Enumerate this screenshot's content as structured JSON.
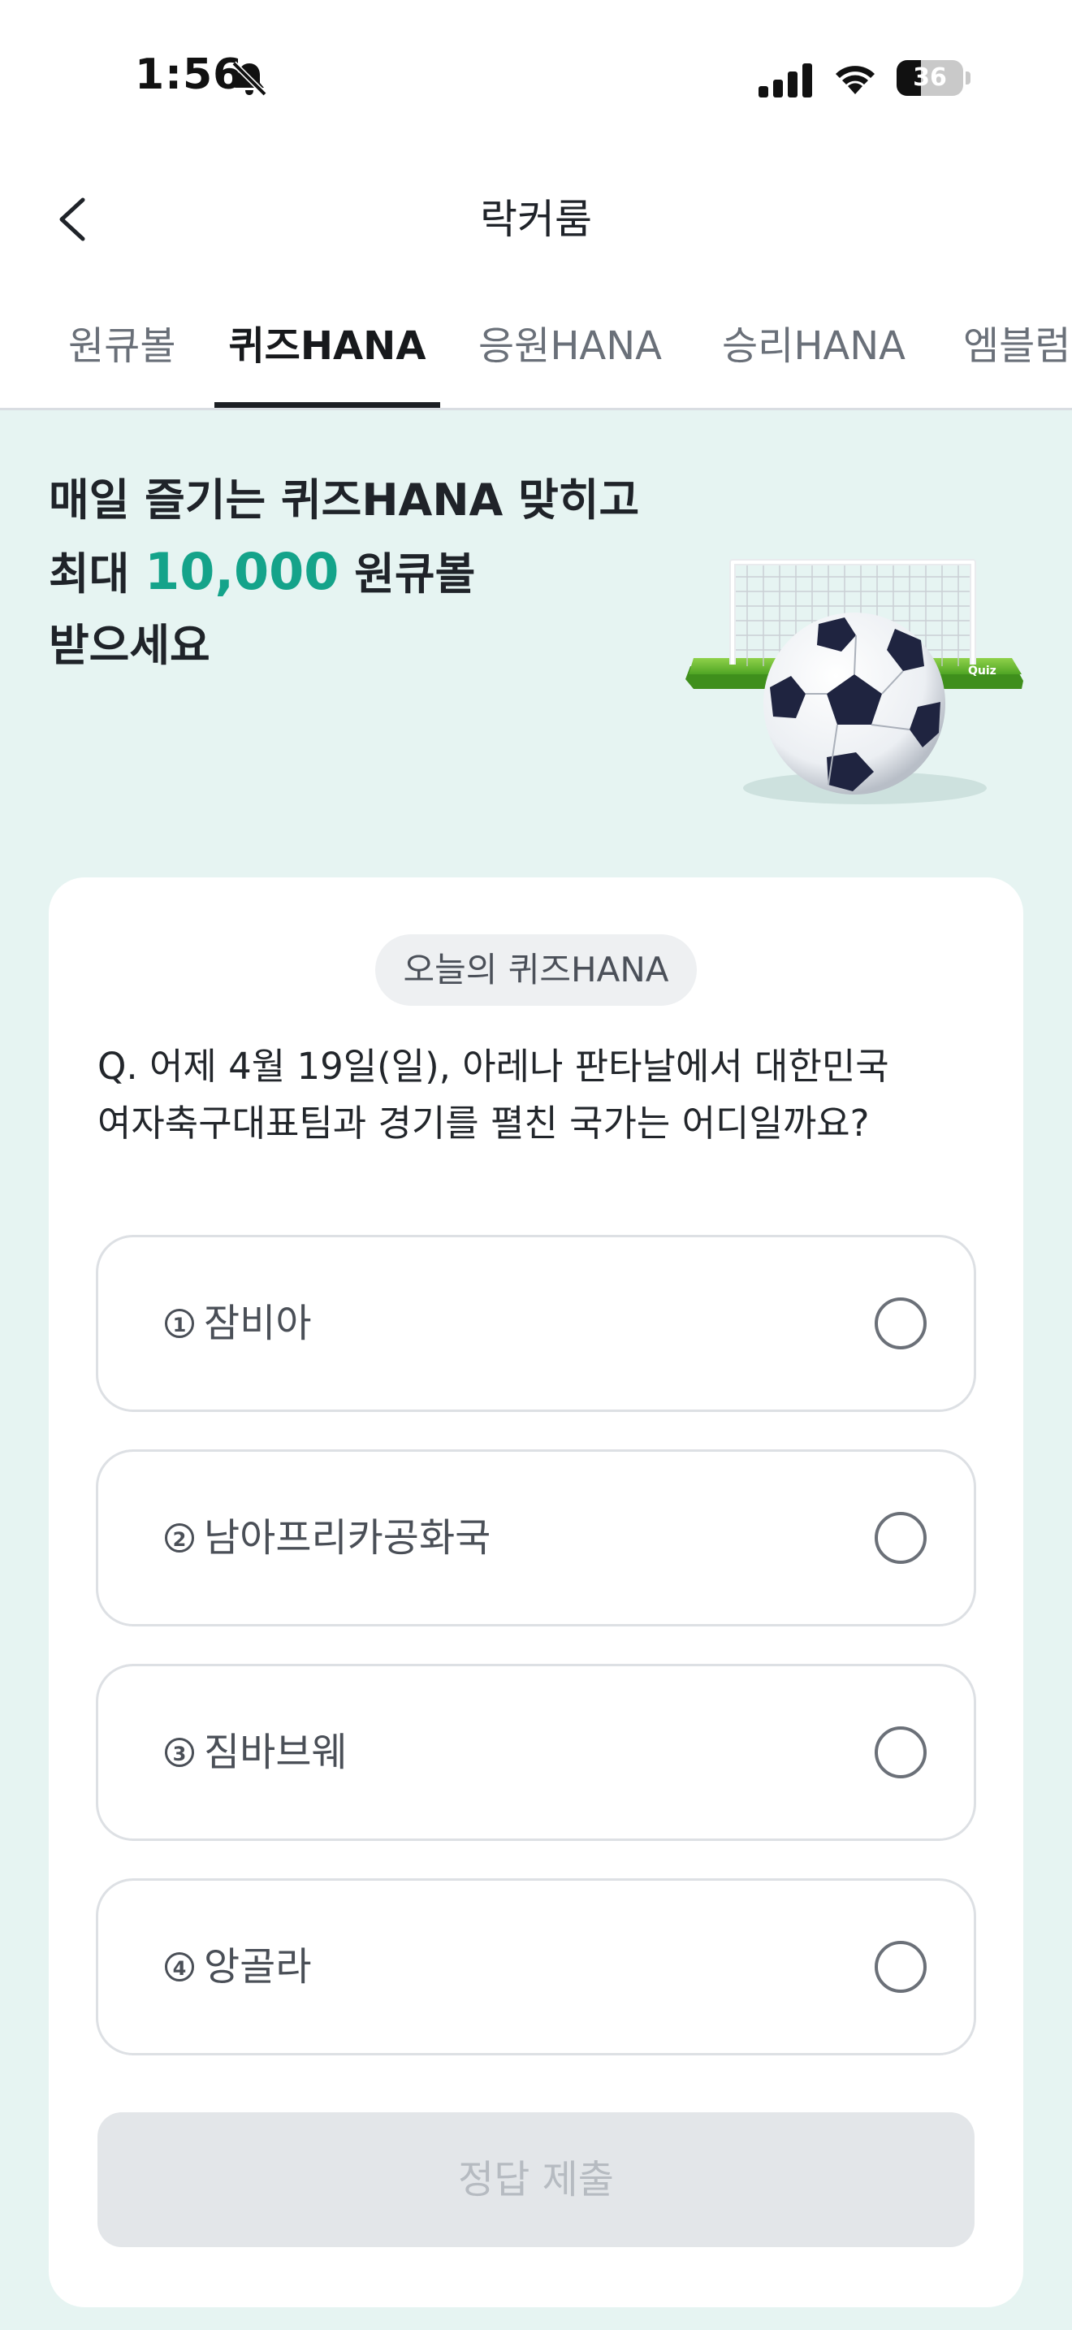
{
  "status_bar": {
    "time": "1:56",
    "battery_level": "36",
    "battery_fraction": 0.36
  },
  "header": {
    "title": "락커룸"
  },
  "tabs": [
    {
      "label": "원큐볼",
      "active": false
    },
    {
      "label": "퀴즈HANA",
      "active": true
    },
    {
      "label": "응원HANA",
      "active": false
    },
    {
      "label": "승리HANA",
      "active": false
    },
    {
      "label": "엠블럼",
      "active": false
    }
  ],
  "hero": {
    "line1": "매일 즐기는 퀴즈HANA 맞히고",
    "line2_prefix": "최대 ",
    "line2_amount": "10,000",
    "line2_suffix": " 원큐볼",
    "line3": "받으세요",
    "art_label": "Quiz"
  },
  "quiz": {
    "badge": "오늘의 퀴즈HANA",
    "question_line1": "Q. 어제 4월 19일(일), 아레나 판타날에서 대한민국",
    "question_line2": "여자축구대표팀과 경기를 펼친 국가는 어디일까요?",
    "options": [
      {
        "num": "1",
        "label": "잠비아"
      },
      {
        "num": "2",
        "label": "남아프리카공화국"
      },
      {
        "num": "3",
        "label": "짐바브웨"
      },
      {
        "num": "4",
        "label": "앙골라"
      }
    ],
    "submit_label": "정답 제출"
  },
  "colors": {
    "background": "#e6f4f2",
    "accent": "#14a38a",
    "submit_disabled_bg": "#e3e6e9"
  },
  "icons": {
    "back": "chevron-left-icon",
    "bell": "bell-slash-icon",
    "signal": "signal-icon",
    "wifi": "wifi-icon",
    "battery": "battery-icon"
  }
}
